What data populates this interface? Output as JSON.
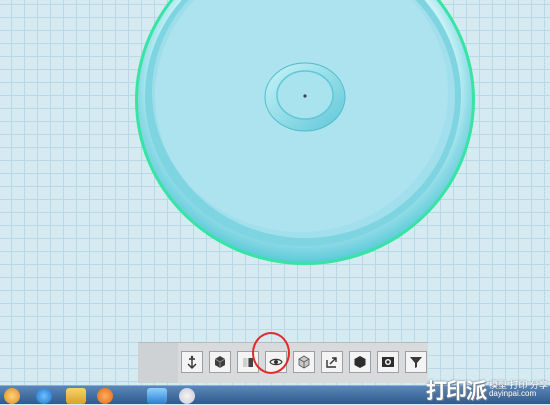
{
  "viewport": {
    "grid_color": "#b9d9e6",
    "background": "#d6eaf2"
  },
  "model": {
    "shape": "ring-disc",
    "fill_color": "#a9e3ee",
    "rim_color": "#5fd0d6",
    "edge_color": "#35e3a3"
  },
  "toolbar": {
    "buttons": [
      {
        "name": "move-tool-button",
        "icon": "move-anchor-icon"
      },
      {
        "name": "view-box-button",
        "icon": "cube-dark-icon"
      },
      {
        "name": "view-front-button",
        "icon": "cube-split-icon"
      },
      {
        "name": "view-eye-button",
        "icon": "eye-icon"
      },
      {
        "name": "view-iso-button",
        "icon": "cube-light-icon"
      },
      {
        "name": "export-button",
        "icon": "share-icon"
      },
      {
        "name": "material-button",
        "icon": "hexagon-icon"
      },
      {
        "name": "snapshot-button",
        "icon": "camera-icon"
      },
      {
        "name": "more-button",
        "icon": "funnel-icon"
      }
    ],
    "highlight_color": "#e32a2a"
  },
  "taskbar": {
    "icons": [
      "start-orb-icon",
      "ie-icon",
      "folder-icon",
      "media-player-icon",
      "app-icon",
      "word-icon",
      "paint-icon"
    ]
  },
  "watermark": {
    "logo": "打印派",
    "tagline": "模型 打印 分享",
    "url": "dayinpai.com"
  }
}
